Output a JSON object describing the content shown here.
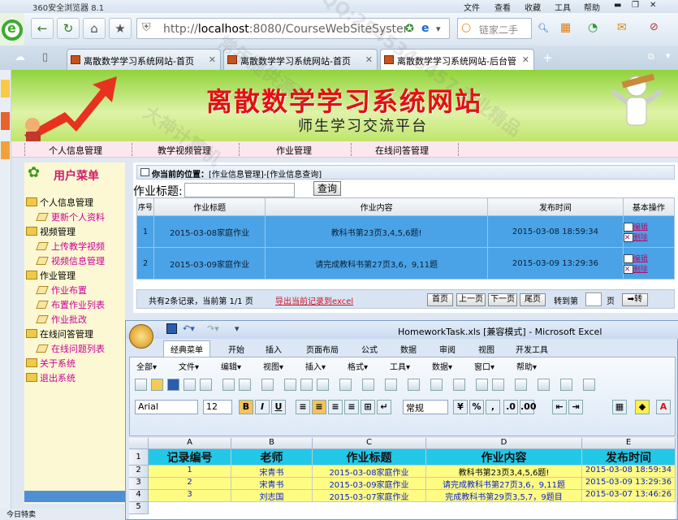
{
  "browser": {
    "title": "360安全浏览器 8.1",
    "menu": [
      "文件",
      "查看",
      "收藏",
      "工具",
      "帮助"
    ],
    "address": {
      "prefix": "http://",
      "host": "localhost",
      "rest": ":8080/CourseWebSiteSystem"
    },
    "search_placeholder": "链家二手",
    "tabs": [
      {
        "label": "离散数学学习系统网站-首页"
      },
      {
        "label": "离散数学学习系统网站-首页"
      },
      {
        "label": "离散数学学习系统网站-后台管"
      }
    ]
  },
  "site": {
    "title": "离散数学学习系统网站",
    "subtitle": "师生学习交流平台",
    "nav": [
      "个人信息管理",
      "教学视频管理",
      "作业管理",
      "在线问答管理"
    ]
  },
  "sidebar": {
    "heading": "用户菜单",
    "tree": [
      {
        "label": "个人信息管理",
        "kind": "fold"
      },
      {
        "label": "更新个人资料",
        "kind": "leaf"
      },
      {
        "label": "视频管理",
        "kind": "fold"
      },
      {
        "label": "上传教学视频",
        "kind": "leaf"
      },
      {
        "label": "视频信息管理",
        "kind": "leaf"
      },
      {
        "label": "作业管理",
        "kind": "fold"
      },
      {
        "label": "作业布置",
        "kind": "leaf"
      },
      {
        "label": "布置作业列表",
        "kind": "leaf"
      },
      {
        "label": "作业批改",
        "kind": "leaf"
      },
      {
        "label": "在线问答管理",
        "kind": "fold"
      },
      {
        "label": "在线问题列表",
        "kind": "leaf"
      },
      {
        "label": "关于系统",
        "kind": "fold"
      },
      {
        "label": "退出系统",
        "kind": "fold"
      }
    ]
  },
  "content": {
    "location_prefix": "你当前的位置：",
    "location_path": "[作业信息管理]-[作业信息查询]",
    "search_label": "作业标题:",
    "search_button": "查询",
    "columns": [
      "序号",
      "作业标题",
      "作业内容",
      "发布时间",
      "基本操作"
    ],
    "rows": [
      {
        "no": "1",
        "title": "2015-03-08家庭作业",
        "content": "教科书第23页3,4,5,6题!",
        "time": "2015-03-08 18:59:34",
        "edit": "编辑",
        "del": "删除"
      },
      {
        "no": "2",
        "title": "2015-03-09家庭作业",
        "content": "请完成教科书第27页3,6，9,11题",
        "time": "2015-03-09 13:29:36",
        "edit": "编辑",
        "del": "删除"
      }
    ],
    "pager": {
      "info": "共有2条记录，当前第 1/1 页",
      "export": "导出当前记录到excel",
      "first": "首页",
      "prev": "上一页",
      "next": "下一页",
      "last": "尾页",
      "goto": "转到第",
      "page_unit": "页",
      "go": "➡转"
    }
  },
  "excel": {
    "title": "HomeworkTask.xls  [兼容模式] - Microsoft Excel",
    "tabs": [
      "经典菜单",
      "开始",
      "插入",
      "页面布局",
      "公式",
      "数据",
      "审阅",
      "视图",
      "开发工具"
    ],
    "menu": [
      "全部▾",
      "文件▾",
      "编辑▾",
      "视图▾",
      "插入▾",
      "格式▾",
      "工具▾",
      "数据▾",
      "窗口▾",
      "帮助▾"
    ],
    "font": "Arial",
    "size": "12",
    "number_format": "常规",
    "columns": [
      "A",
      "B",
      "C",
      "D",
      "E"
    ],
    "rows": [
      "1",
      "2",
      "3",
      "4",
      "5"
    ],
    "headers": [
      "记录编号",
      "老师",
      "作业标题",
      "作业内容",
      "发布时间"
    ],
    "data": [
      [
        "1",
        "宋青书",
        "2015-03-08家庭作业",
        "教科书第23页3,4,5,6题!",
        "2015-03-08 18:59:34"
      ],
      [
        "2",
        "宋青书",
        "2015-03-09家庭作业",
        "请完成教科书第27页3,6，9,11题",
        "2015-03-09 13:29:36"
      ],
      [
        "3",
        "刘志国",
        "2015-03-07家庭作业",
        "完成教科书第29页3,5,7，9题目",
        "2015-03-07 13:46:26"
      ]
    ]
  },
  "status": "今日特卖",
  "watermarks": [
    "QQ:2545340457",
    "大神计算机",
    "常年提供源码",
    "专业精品"
  ]
}
